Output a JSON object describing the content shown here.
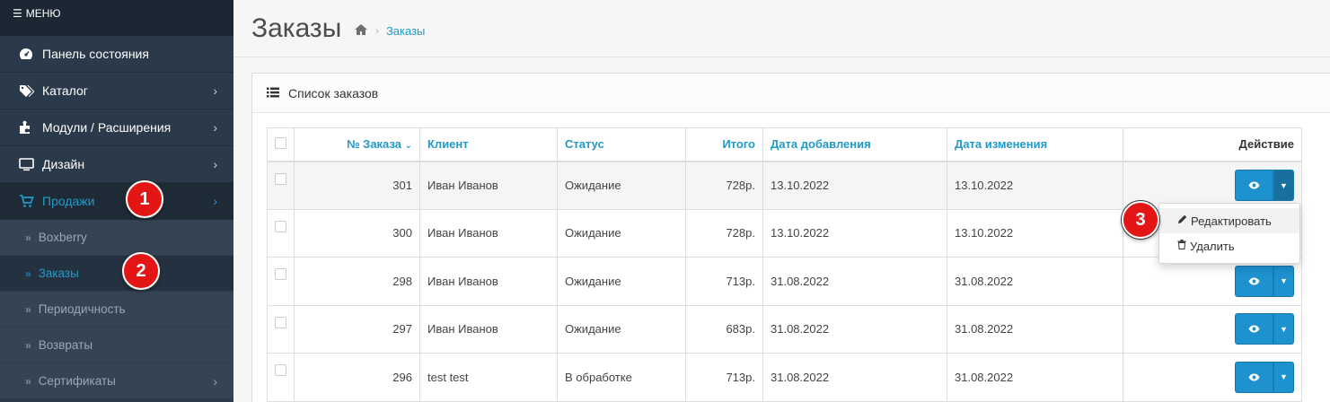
{
  "menu": {
    "title": "МЕНЮ"
  },
  "sidebar": {
    "items": [
      {
        "label": "Панель состояния",
        "icon": "dashboard-icon"
      },
      {
        "label": "Каталог",
        "icon": "tags-icon"
      },
      {
        "label": "Модули / Расширения",
        "icon": "puzzle-icon"
      },
      {
        "label": "Дизайн",
        "icon": "monitor-icon"
      },
      {
        "label": "Продажи",
        "icon": "cart-icon"
      }
    ],
    "subitems": [
      {
        "label": "Boxberry"
      },
      {
        "label": "Заказы"
      },
      {
        "label": "Периодичность"
      },
      {
        "label": "Возвраты"
      },
      {
        "label": "Сертификаты"
      }
    ]
  },
  "page": {
    "title": "Заказы",
    "breadcrumb": "Заказы"
  },
  "panel": {
    "title": "Список заказов"
  },
  "table": {
    "headers": {
      "order": "№ Заказа",
      "client": "Клиент",
      "status": "Статус",
      "total": "Итого",
      "added": "Дата добавления",
      "modified": "Дата изменения",
      "action": "Действие"
    },
    "rows": [
      {
        "order": "301",
        "client": "Иван Иванов",
        "status": "Ожидание",
        "total": "728р.",
        "added": "13.10.2022",
        "modified": "13.10.2022"
      },
      {
        "order": "300",
        "client": "Иван Иванов",
        "status": "Ожидание",
        "total": "728р.",
        "added": "13.10.2022",
        "modified": "13.10.2022"
      },
      {
        "order": "298",
        "client": "Иван Иванов",
        "status": "Ожидание",
        "total": "713р.",
        "added": "31.08.2022",
        "modified": "31.08.2022"
      },
      {
        "order": "297",
        "client": "Иван Иванов",
        "status": "Ожидание",
        "total": "683р.",
        "added": "31.08.2022",
        "modified": "31.08.2022"
      },
      {
        "order": "296",
        "client": "test test",
        "status": "В обработке",
        "total": "713р.",
        "added": "31.08.2022",
        "modified": "31.08.2022"
      }
    ]
  },
  "dropdown": {
    "edit": "Редактировать",
    "delete": "Удалить"
  },
  "markers": [
    "1",
    "2",
    "3"
  ],
  "colors": {
    "accent": "#229ac8",
    "button": "#1e91cf",
    "sidebar": "#2b3a4a",
    "marker": "#e31515"
  }
}
